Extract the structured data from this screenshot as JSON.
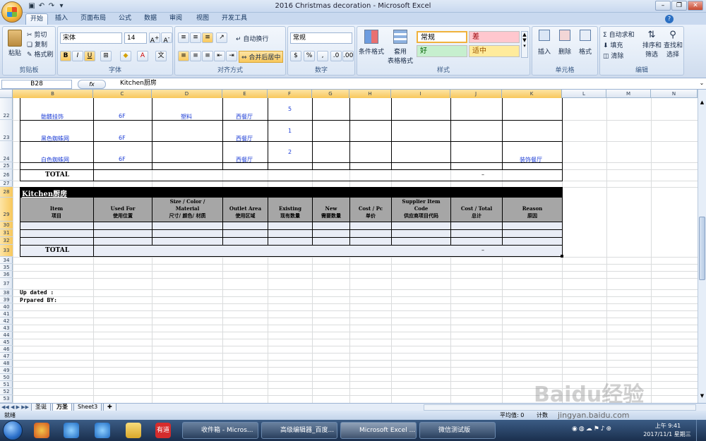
{
  "window": {
    "title": "2016 Christmas decoration - Microsoft Excel"
  },
  "tabs": [
    "开始",
    "插入",
    "页面布局",
    "公式",
    "数据",
    "审阅",
    "视图",
    "开发工具"
  ],
  "ribbon": {
    "clipboard": {
      "paste": "粘贴",
      "cut": "剪切",
      "copy": "复制",
      "format_painter": "格式刷",
      "label": "剪贴板"
    },
    "font": {
      "name": "宋体",
      "size": "14",
      "label": "字体"
    },
    "alignment": {
      "wrap": "自动换行",
      "merge": "合并后居中",
      "label": "对齐方式"
    },
    "number": {
      "format": "常规",
      "label": "数字"
    },
    "styles": {
      "conditional": "条件格式",
      "table_line1": "套用",
      "table_line2": "表格格式",
      "normal": "常规",
      "bad": "差",
      "good": "好",
      "neutral": "适中",
      "label": "样式"
    },
    "cells": {
      "insert": "插入",
      "delete": "删除",
      "format": "格式",
      "label": "单元格"
    },
    "editing": {
      "autosum": "自动求和",
      "fill": "填充",
      "clear": "清除",
      "sort1": "排序和",
      "sort2": "筛选",
      "find1": "查找和",
      "find2": "选择",
      "label": "编辑"
    }
  },
  "formula_bar": {
    "name_box": "B28",
    "fx": "fx",
    "content": "Kitchen厨房"
  },
  "columns": [
    "B",
    "C",
    "D",
    "E",
    "F",
    "G",
    "H",
    "I",
    "J",
    "K",
    "L",
    "M",
    "N"
  ],
  "rows": {
    "r22": {
      "num": "22",
      "b": "骷髅挂饰",
      "c": "6F",
      "d": "塑料",
      "e": "西餐厅",
      "f": "5"
    },
    "r23": {
      "num": "23",
      "b": "黑色蜘蛛网",
      "c": "6F",
      "e": "西餐厅",
      "f": "1"
    },
    "r24": {
      "num": "24",
      "b": "白色蜘蛛网",
      "c": "6F",
      "e": "西餐厅",
      "f": "2",
      "k": "装饰餐厅"
    },
    "r25": {
      "num": "25"
    },
    "r26": {
      "num": "26",
      "b": "TOTAL",
      "j": "–"
    },
    "r27": {
      "num": "27"
    },
    "r28": {
      "num": "28",
      "title": "Kitchen厨房"
    },
    "r29": {
      "num": "29"
    },
    "r30": {
      "num": "30"
    },
    "r31": {
      "num": "31"
    },
    "r32": {
      "num": "32"
    },
    "r33": {
      "num": "33",
      "b": "TOTAL",
      "j": "–"
    },
    "r38": {
      "num": "38",
      "b": "Up dated :"
    },
    "r39": {
      "num": "39",
      "b": "Prpared BY:"
    }
  },
  "kitchen_headers": {
    "b": {
      "en": "Item",
      "zh": "项目"
    },
    "c": {
      "en": "Used For",
      "zh": "使用位置"
    },
    "d": {
      "en": "Size  / Color / Material",
      "zh": "尺寸/ 颜色/ 材质"
    },
    "e": {
      "en": "Outlet Area",
      "zh": "使用区域"
    },
    "f": {
      "en": "Existing",
      "zh": "现有数量"
    },
    "g": {
      "en": "New",
      "zh": "需要数量"
    },
    "h": {
      "en": "Cost / Pc",
      "zh": "单价"
    },
    "i": {
      "en": "Supplier Item Code",
      "zh": "供应商项目代码"
    },
    "j": {
      "en": "Cost / Total",
      "zh": "总计"
    },
    "k": {
      "en": "Reason",
      "zh": "原因"
    }
  },
  "extra_rows": [
    "34",
    "35",
    "36",
    "37",
    "40",
    "41",
    "42",
    "43",
    "44",
    "45",
    "46",
    "47",
    "48",
    "49",
    "50",
    "51",
    "52",
    "53"
  ],
  "sheet_tabs": [
    "圣诞",
    "万圣",
    "Sheet3"
  ],
  "status": {
    "ready": "就绪",
    "average": "平均值: 0",
    "count": "计数"
  },
  "taskbar": {
    "items": [
      "有道",
      "收件箱 - Micros...",
      "高级编辑器_百度...",
      "Microsoft Excel ...",
      "微信测试版"
    ],
    "time": "上午 9:41",
    "date": "2017/11/1 星期三"
  },
  "watermark": "Baidu经验",
  "watermark_url": "jingyan.baidu.com"
}
